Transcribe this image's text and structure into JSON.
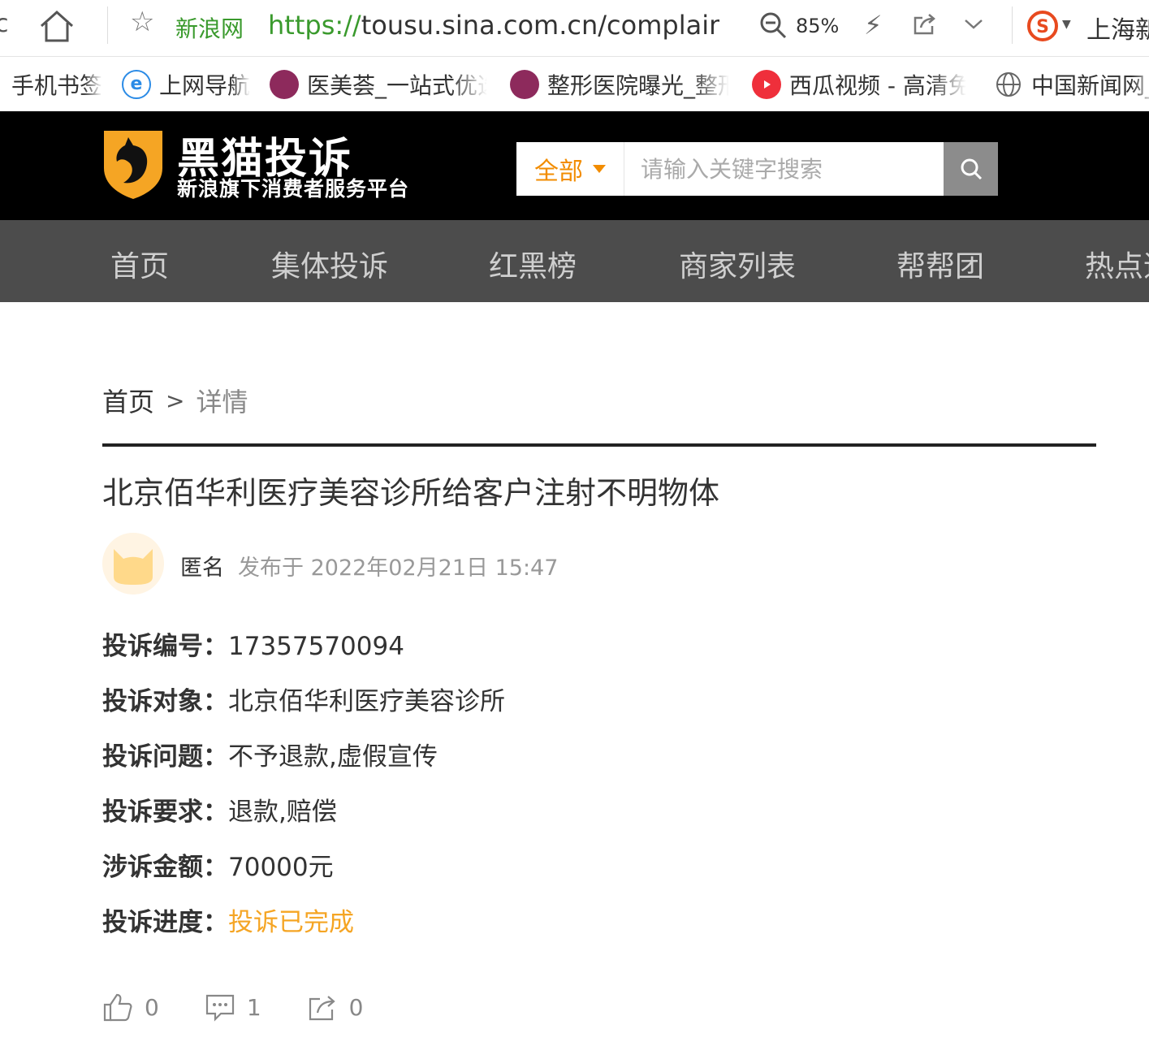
{
  "browser": {
    "back_glyph": "ⅽ",
    "site_name": "新浪网",
    "url_scheme": "https://",
    "url_rest": "tousu.sina.com.cn/complaint/",
    "zoom": "85%",
    "search_hint": "上海新"
  },
  "bookmarks": [
    {
      "label": "手机书签",
      "icon": "none"
    },
    {
      "label": "上网导航",
      "icon": "ie-icon"
    },
    {
      "label": "医美荟_一站式优选",
      "icon": "yimeihui-icon"
    },
    {
      "label": "整形医院曝光_整形",
      "icon": "yimeihui-icon"
    },
    {
      "label": "西瓜视频 - 高清免",
      "icon": "xigua-icon"
    },
    {
      "label": "中国新闻网_",
      "icon": "globe-icon"
    }
  ],
  "header": {
    "brand_title": "黑猫投诉",
    "brand_slogan": "新浪旗下消费者服务平台",
    "scope_label": "全部",
    "search_placeholder": "请输入关键字搜索"
  },
  "nav": {
    "items": [
      "首页",
      "集体投诉",
      "红黑榜",
      "商家列表",
      "帮帮团",
      "热点追踪"
    ]
  },
  "breadcrumb": {
    "home": "首页",
    "separator": ">",
    "current": "详情"
  },
  "complaint": {
    "title": "北京佰华利医疗美容诊所给客户注射不明物体",
    "author": "匿名",
    "published": "发布于 2022年02月21日 15:47",
    "fields": [
      {
        "label": "投诉编号：",
        "value": "17357570094"
      },
      {
        "label": "投诉对象：",
        "value": "北京佰华利医疗美容诊所"
      },
      {
        "label": "投诉问题：",
        "value": "不予退款,虚假宣传"
      },
      {
        "label": "投诉要求：",
        "value": "退款,赔偿"
      },
      {
        "label": "涉诉金额：",
        "value": "70000元"
      },
      {
        "label": "投诉进度：",
        "value": "投诉已完成"
      }
    ],
    "likes": "0",
    "comments": "1",
    "shares": "0"
  },
  "colors": {
    "accent_orange": "#f28c00",
    "status_done": "#f5a524",
    "header_bg": "#000000",
    "nav_bg": "#4c4c4c",
    "url_green": "#3a9a2d"
  }
}
